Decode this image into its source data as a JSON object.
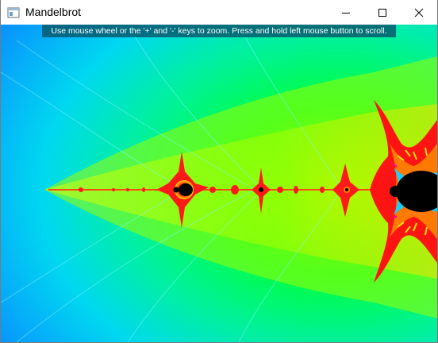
{
  "window": {
    "title": "Mandelbrot",
    "app_icon": "window-app-icon",
    "controls": {
      "minimize_icon": "minimize-icon",
      "maximize_icon": "maximize-icon",
      "close_icon": "close-icon"
    }
  },
  "viewer": {
    "hint": "Use mouse wheel or the '+' and '-' keys to zoom. Press and hold left mouse button to scroll."
  },
  "colors": {
    "titlebar": "#ffffff",
    "hint_bg": "#065a6e",
    "fractal_blue": "#0a8aff",
    "fractal_cyan": "#00e8ff",
    "fractal_green": "#00ff40",
    "fractal_yellow": "#ffe800",
    "fractal_red": "#ff1010",
    "fractal_set": "#000000"
  }
}
